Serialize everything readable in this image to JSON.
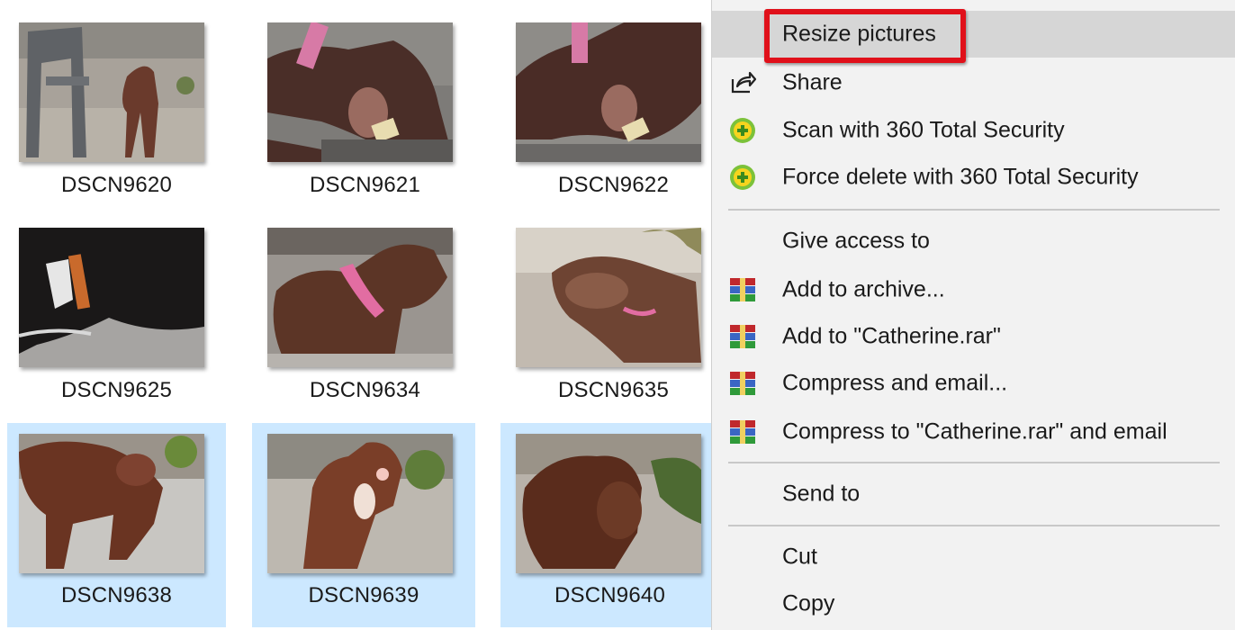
{
  "files": [
    {
      "name": "DSCN9620",
      "selected": false
    },
    {
      "name": "DSCN9621",
      "selected": false
    },
    {
      "name": "DSCN9622",
      "selected": false
    },
    {
      "name": "DSCN9625",
      "selected": false
    },
    {
      "name": "DSCN9634",
      "selected": false
    },
    {
      "name": "DSCN9635",
      "selected": false
    },
    {
      "name": "DSCN9638",
      "selected": true
    },
    {
      "name": "DSCN9639",
      "selected": true
    },
    {
      "name": "DSCN9640",
      "selected": true
    }
  ],
  "context_menu": {
    "items": [
      {
        "label": "Resize pictures",
        "icon": "",
        "highlighted": true
      },
      {
        "label": "Share",
        "icon": "share-icon"
      },
      {
        "label": "Scan with 360 Total Security",
        "icon": "360-security-icon"
      },
      {
        "label": "Force delete with 360 Total Security",
        "icon": "360-security-icon"
      },
      {
        "label": "Give access to",
        "icon": ""
      },
      {
        "label": "Add to archive...",
        "icon": "winrar-icon"
      },
      {
        "label": "Add to \"Catherine.rar\"",
        "icon": "winrar-icon"
      },
      {
        "label": "Compress and email...",
        "icon": "winrar-icon"
      },
      {
        "label": "Compress to \"Catherine.rar\" and email",
        "icon": "winrar-icon"
      },
      {
        "label": "Send to",
        "icon": ""
      },
      {
        "label": "Cut",
        "icon": ""
      },
      {
        "label": "Copy",
        "icon": ""
      }
    ]
  },
  "colors": {
    "selection": "#cce8ff",
    "menu_background": "#f2f2f2",
    "menu_hover": "#d6d6d6",
    "annotation_box": "#e0101a"
  }
}
